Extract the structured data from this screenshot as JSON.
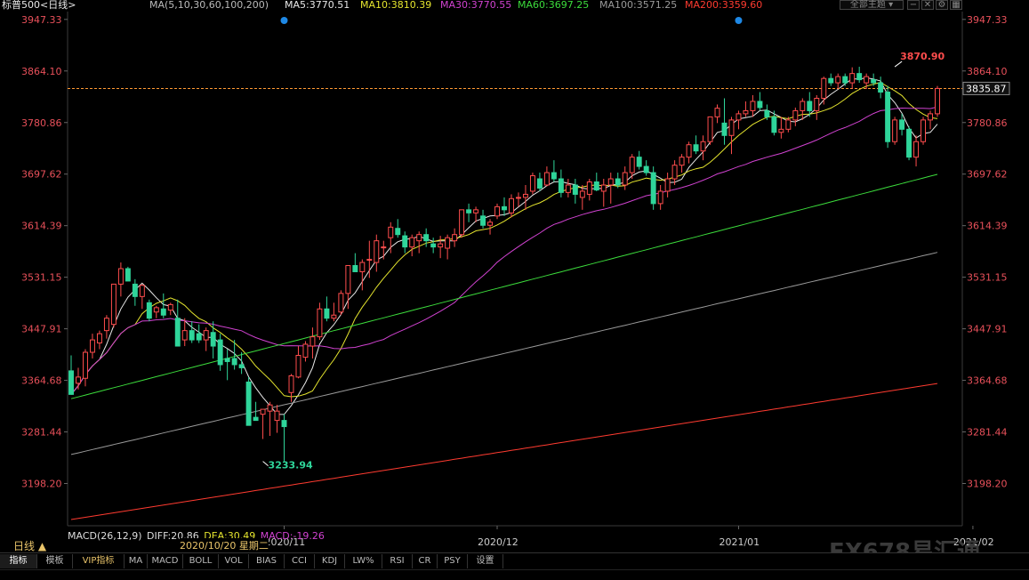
{
  "header": {
    "symbol_label": "标普500<日线>",
    "ma_params": "MA(5,10,30,60,100,200)",
    "ma_values": [
      {
        "label": "MA5:3770.51",
        "color": "#e8e8e8"
      },
      {
        "label": "MA10:3810.39",
        "color": "#e5e52e"
      },
      {
        "label": "MA30:3770.55",
        "color": "#d042d0"
      },
      {
        "label": "MA60:3697.25",
        "color": "#3cdc3c"
      },
      {
        "label": "MA100:3571.25",
        "color": "#9a9a9a"
      },
      {
        "label": "MA200:3359.60",
        "color": "#ff3b30"
      }
    ],
    "theme_button": "全部主题",
    "theme_arrow": "▾"
  },
  "macd": {
    "title": "MACD(26,12,9)",
    "diff": "DIFF:20.86",
    "dea": "DEA:30.49",
    "macd": "MACD:-19.26"
  },
  "period_label": "日线 ▲",
  "date_tip": "2020/10/20 星期二",
  "watermark": "FX678易汇通",
  "tabs": [
    "指标",
    "模板",
    "VIP指标",
    "MA",
    "MACD",
    "BOLL",
    "VOL",
    "BIAS",
    "CCI",
    "KDJ",
    "LW%",
    "RSI",
    "CR",
    "PSY",
    "设置"
  ],
  "colors": {
    "up": "#ff4d4d",
    "down": "#2fd59a",
    "axis_text": "#e8505a",
    "last_price_line": "#ff9933"
  },
  "chart_data": {
    "type": "candlestick",
    "y_ticks": [
      "3947.33",
      "3864.10",
      "3780.86",
      "3697.62",
      "3614.39",
      "3531.15",
      "3447.91",
      "3364.68",
      "3281.44",
      "3198.20"
    ],
    "ylim": [
      3130,
      3960
    ],
    "x_labels": [
      {
        "label": "2020/11",
        "index": 30
      },
      {
        "label": "2020/12",
        "index": 60
      },
      {
        "label": "2021/01",
        "index": 94
      },
      {
        "label": "2021/02",
        "index": 127
      }
    ],
    "last_price": 3835.87,
    "high_annotation": {
      "label": "3870.90",
      "index": 116,
      "value": 3870.9
    },
    "low_annotation": {
      "label": "3233.94",
      "index": 27,
      "value": 3233.94
    },
    "candles": [
      [
        3380,
        3405,
        3342,
        3342
      ],
      [
        3360,
        3385,
        3350,
        3370
      ],
      [
        3368,
        3415,
        3355,
        3410
      ],
      [
        3410,
        3440,
        3400,
        3430
      ],
      [
        3425,
        3445,
        3415,
        3440
      ],
      [
        3445,
        3470,
        3432,
        3465
      ],
      [
        3455,
        3520,
        3450,
        3520
      ],
      [
        3520,
        3555,
        3500,
        3545
      ],
      [
        3545,
        3548,
        3525,
        3525
      ],
      [
        3520,
        3528,
        3485,
        3500
      ],
      [
        3500,
        3520,
        3480,
        3518
      ],
      [
        3490,
        3495,
        3460,
        3465
      ],
      [
        3475,
        3485,
        3465,
        3482
      ],
      [
        3480,
        3505,
        3465,
        3470
      ],
      [
        3478,
        3490,
        3470,
        3487
      ],
      [
        3465,
        3495,
        3420,
        3420
      ],
      [
        3430,
        3465,
        3420,
        3445
      ],
      [
        3445,
        3460,
        3425,
        3430
      ],
      [
        3440,
        3455,
        3425,
        3430
      ],
      [
        3430,
        3450,
        3412,
        3445
      ],
      [
        3442,
        3460,
        3400,
        3420
      ],
      [
        3430,
        3440,
        3380,
        3390
      ],
      [
        3400,
        3415,
        3365,
        3395
      ],
      [
        3400,
        3430,
        3382,
        3390
      ],
      [
        3390,
        3410,
        3375,
        3385
      ],
      [
        3362,
        3370,
        3292,
        3292
      ],
      [
        3305,
        3330,
        3300,
        3300
      ],
      [
        3310,
        3318,
        3270,
        3318
      ],
      [
        3315,
        3330,
        3275,
        3325
      ],
      [
        3300,
        3325,
        3280,
        3315
      ],
      [
        3300,
        3310,
        3233.94,
        3290
      ],
      [
        3345,
        3375,
        3330,
        3372
      ],
      [
        3370,
        3420,
        3368,
        3405
      ],
      [
        3402,
        3428,
        3395,
        3423
      ],
      [
        3420,
        3450,
        3400,
        3435
      ],
      [
        3435,
        3490,
        3430,
        3480
      ],
      [
        3480,
        3500,
        3460,
        3465
      ],
      [
        3465,
        3490,
        3460,
        3470
      ],
      [
        3475,
        3510,
        3470,
        3505
      ],
      [
        3505,
        3550,
        3480,
        3550
      ],
      [
        3550,
        3570,
        3540,
        3540
      ],
      [
        3540,
        3560,
        3510,
        3555
      ],
      [
        3560,
        3590,
        3530,
        3560
      ],
      [
        3555,
        3600,
        3540,
        3590
      ],
      [
        3580,
        3590,
        3560,
        3580
      ],
      [
        3595,
        3620,
        3570,
        3612
      ],
      [
        3610,
        3625,
        3595,
        3600
      ],
      [
        3598,
        3605,
        3570,
        3580
      ],
      [
        3580,
        3600,
        3565,
        3595
      ],
      [
        3590,
        3605,
        3570,
        3600
      ],
      [
        3600,
        3610,
        3580,
        3590
      ],
      [
        3585,
        3595,
        3570,
        3580
      ],
      [
        3580,
        3598,
        3562,
        3585
      ],
      [
        3578,
        3600,
        3560,
        3595
      ],
      [
        3590,
        3610,
        3580,
        3600
      ],
      [
        3600,
        3640,
        3595,
        3640
      ],
      [
        3640,
        3650,
        3620,
        3635
      ],
      [
        3635,
        3645,
        3620,
        3640
      ],
      [
        3630,
        3640,
        3610,
        3615
      ],
      [
        3615,
        3625,
        3600,
        3620
      ],
      [
        3630,
        3650,
        3625,
        3645
      ],
      [
        3645,
        3660,
        3630,
        3640
      ],
      [
        3635,
        3665,
        3628,
        3658
      ],
      [
        3660,
        3668,
        3645,
        3660
      ],
      [
        3660,
        3680,
        3640,
        3665
      ],
      [
        3670,
        3700,
        3665,
        3695
      ],
      [
        3690,
        3700,
        3670,
        3675
      ],
      [
        3680,
        3710,
        3678,
        3700
      ],
      [
        3700,
        3720,
        3685,
        3690
      ],
      [
        3690,
        3705,
        3660,
        3668
      ],
      [
        3668,
        3690,
        3660,
        3680
      ],
      [
        3680,
        3690,
        3650,
        3665
      ],
      [
        3660,
        3680,
        3640,
        3670
      ],
      [
        3665,
        3690,
        3655,
        3685
      ],
      [
        3685,
        3700,
        3670,
        3672
      ],
      [
        3670,
        3690,
        3645,
        3680
      ],
      [
        3680,
        3700,
        3650,
        3690
      ],
      [
        3690,
        3700,
        3675,
        3680
      ],
      [
        3680,
        3710,
        3672,
        3700
      ],
      [
        3700,
        3730,
        3690,
        3725
      ],
      [
        3725,
        3735,
        3705,
        3710
      ],
      [
        3710,
        3720,
        3695,
        3700
      ],
      [
        3700,
        3710,
        3640,
        3650
      ],
      [
        3650,
        3680,
        3640,
        3670
      ],
      [
        3670,
        3700,
        3660,
        3690
      ],
      [
        3690,
        3720,
        3680,
        3712
      ],
      [
        3712,
        3730,
        3700,
        3725
      ],
      [
        3725,
        3750,
        3715,
        3745
      ],
      [
        3745,
        3760,
        3730,
        3735
      ],
      [
        3735,
        3760,
        3720,
        3750
      ],
      [
        3750,
        3790,
        3745,
        3790
      ],
      [
        3790,
        3810,
        3780,
        3804
      ],
      [
        3780,
        3820,
        3745,
        3760
      ],
      [
        3760,
        3790,
        3730,
        3785
      ],
      [
        3785,
        3800,
        3770,
        3795
      ],
      [
        3795,
        3815,
        3790,
        3800
      ],
      [
        3800,
        3825,
        3790,
        3815
      ],
      [
        3815,
        3830,
        3800,
        3805
      ],
      [
        3800,
        3810,
        3785,
        3790
      ],
      [
        3790,
        3800,
        3760,
        3765
      ],
      [
        3765,
        3790,
        3755,
        3770
      ],
      [
        3770,
        3790,
        3765,
        3785
      ],
      [
        3785,
        3805,
        3775,
        3800
      ],
      [
        3800,
        3820,
        3785,
        3815
      ],
      [
        3815,
        3830,
        3790,
        3800
      ],
      [
        3800,
        3825,
        3785,
        3820
      ],
      [
        3820,
        3855,
        3810,
        3852
      ],
      [
        3852,
        3860,
        3840,
        3845
      ],
      [
        3845,
        3860,
        3835,
        3855
      ],
      [
        3855,
        3860,
        3840,
        3845
      ],
      [
        3845,
        3870,
        3835,
        3860
      ],
      [
        3860,
        3870.9,
        3845,
        3850
      ],
      [
        3845,
        3860,
        3835,
        3855
      ],
      [
        3850,
        3860,
        3840,
        3845
      ],
      [
        3845,
        3855,
        3820,
        3830
      ],
      [
        3830,
        3840,
        3740,
        3750
      ],
      [
        3750,
        3790,
        3745,
        3785
      ],
      [
        3785,
        3795,
        3760,
        3770
      ],
      [
        3770,
        3775,
        3720,
        3725
      ],
      [
        3725,
        3760,
        3710,
        3750
      ],
      [
        3750,
        3790,
        3745,
        3785
      ],
      [
        3785,
        3800,
        3770,
        3795
      ],
      [
        3795,
        3840,
        3790,
        3835.87
      ]
    ]
  }
}
